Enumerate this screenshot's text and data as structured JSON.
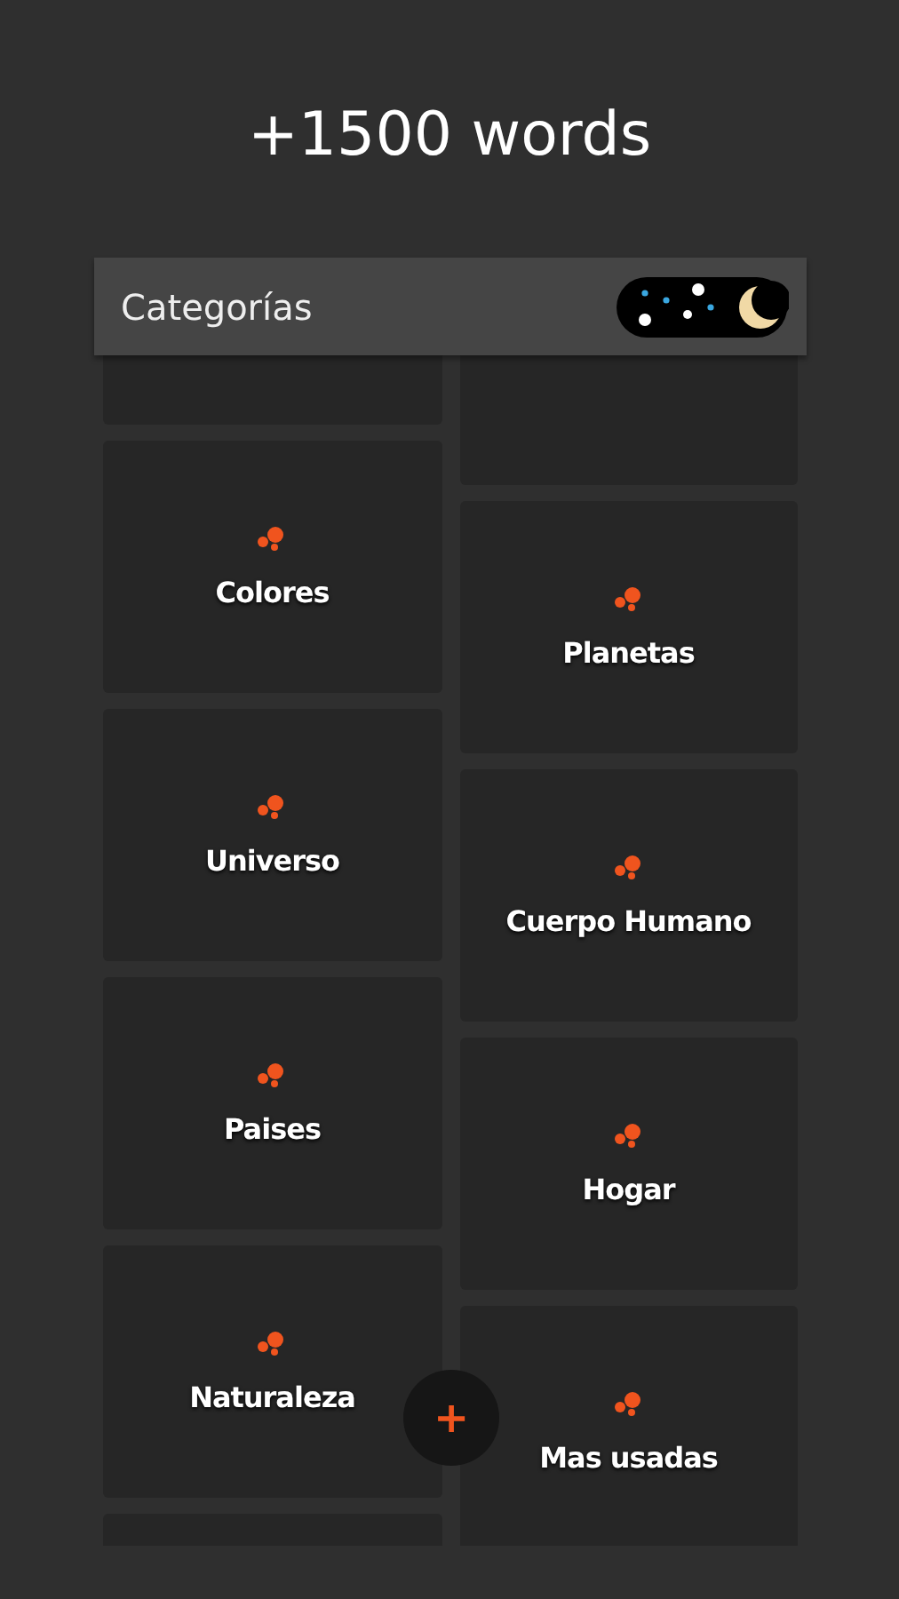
{
  "title": "+1500 words",
  "header": {
    "title": "Categorías",
    "night_mode": true
  },
  "columns": [
    [
      {
        "kind": "blank"
      },
      {
        "kind": "category",
        "label": "Colores"
      },
      {
        "kind": "category",
        "label": "Universo"
      },
      {
        "kind": "category",
        "label": "Paises"
      },
      {
        "kind": "category",
        "label": "Naturaleza"
      },
      {
        "kind": "blank"
      }
    ],
    [
      {
        "kind": "blank"
      },
      {
        "kind": "category",
        "label": "Planetas"
      },
      {
        "kind": "category",
        "label": "Cuerpo Humano"
      },
      {
        "kind": "category",
        "label": "Hogar"
      },
      {
        "kind": "category",
        "label": "Mas usadas"
      }
    ]
  ],
  "fab": {
    "symbol": "+"
  }
}
